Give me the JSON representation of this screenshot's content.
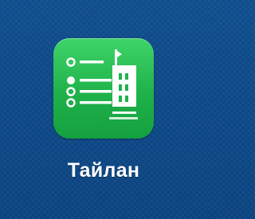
{
  "app": {
    "label": "Тайлан",
    "icon": "report-list-building-icon"
  },
  "colors": {
    "desktop_background": "#0e4a86",
    "icon_green": "#1fb24b",
    "icon_glyph": "#ffffff"
  }
}
